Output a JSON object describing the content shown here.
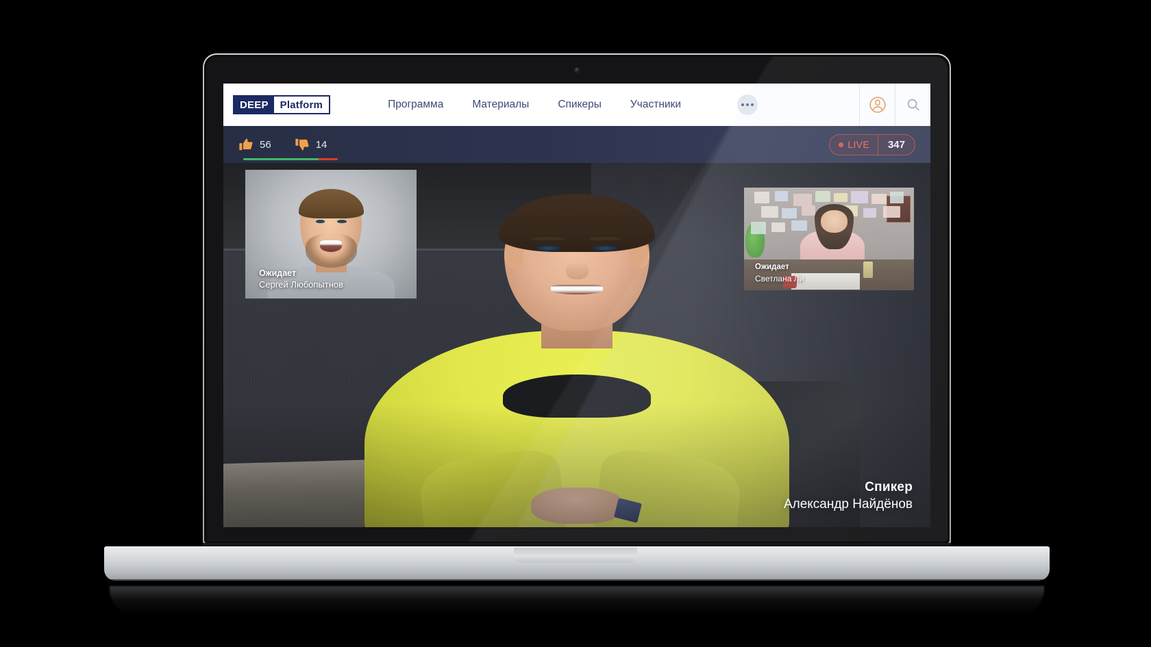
{
  "device": {
    "type": "laptop-mockup",
    "camera_label": "webcam"
  },
  "header": {
    "logo": {
      "primary": "DEEP",
      "secondary": "Platform"
    },
    "nav": [
      {
        "label": "Программа"
      },
      {
        "label": "Материалы"
      },
      {
        "label": "Спикеры"
      },
      {
        "label": "Участники"
      }
    ],
    "more_button": {
      "icon": "ellipsis-icon",
      "label": ""
    },
    "account_icon": "user-avatar-icon",
    "search_icon": "search-icon",
    "colors": {
      "logo_navy": "#1b2a63",
      "nav_text": "#3d4a76",
      "accent_orange": "#e89b55"
    }
  },
  "status_bar": {
    "like": {
      "icon": "thumbs-up-icon",
      "count": "56"
    },
    "dislike": {
      "icon": "thumbs-down-icon",
      "count": "14"
    },
    "rating": {
      "positive_pct": 80,
      "negative_pct": 20,
      "positive_color": "#43b86a",
      "negative_color": "#d93c32"
    },
    "live": {
      "label": "LIVE",
      "viewers": "347",
      "dot_color": "#e8503f",
      "text_color": "#ef6a55"
    },
    "background_color": "#2d3450"
  },
  "stage": {
    "thumbnails": [
      {
        "position": "left",
        "status": "Ожидает",
        "name": "Сергей Любопытнов"
      },
      {
        "position": "right",
        "status": "Ожидает",
        "name": "Светлана Ли"
      }
    ],
    "main_speaker": {
      "role": "Спикер",
      "name": "Александр Найдёнов"
    }
  }
}
